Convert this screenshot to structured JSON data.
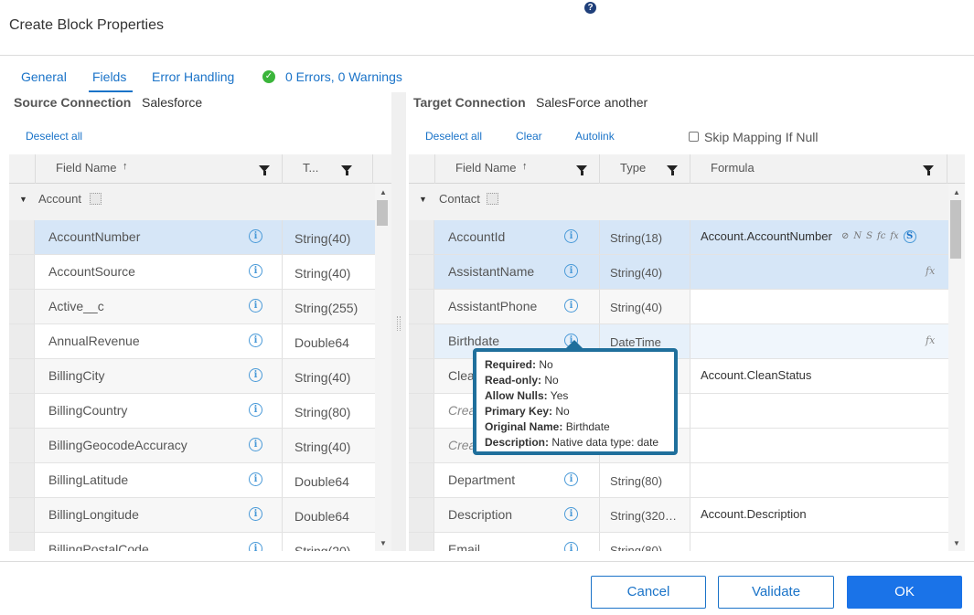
{
  "dialog": {
    "title": "Create Block Properties",
    "help_icon": "?"
  },
  "tabs": [
    "General",
    "Fields",
    "Error Handling"
  ],
  "status": {
    "text": "0 Errors, 0 Warnings",
    "icon": "check-circle-icon",
    "color": "#3bb53b"
  },
  "source": {
    "label": "Source Connection",
    "value": "Salesforce",
    "deselect_all": "Deselect all",
    "columns": {
      "field_name": "Field Name",
      "type": "T..."
    },
    "group": "Account",
    "rows": [
      {
        "name": "AccountNumber",
        "type": "String(40)"
      },
      {
        "name": "AccountSource",
        "type": "String(40)"
      },
      {
        "name": "Active__c",
        "type": "String(255)"
      },
      {
        "name": "AnnualRevenue",
        "type": "Double64"
      },
      {
        "name": "BillingCity",
        "type": "String(40)"
      },
      {
        "name": "BillingCountry",
        "type": "String(80)"
      },
      {
        "name": "BillingGeocodeAccuracy",
        "type": "String(40)"
      },
      {
        "name": "BillingLatitude",
        "type": "Double64"
      },
      {
        "name": "BillingLongitude",
        "type": "Double64"
      },
      {
        "name": "BillingPostalCode",
        "type": "String(20)"
      }
    ]
  },
  "target": {
    "label": "Target Connection",
    "value": "SalesForce another",
    "deselect_all": "Deselect all",
    "clear": "Clear",
    "autolink": "Autolink",
    "skip_null": "Skip Mapping If Null",
    "columns": {
      "field_name": "Field Name",
      "type": "Type",
      "formula": "Formula"
    },
    "group": "Contact",
    "rows": [
      {
        "name": "AccountId",
        "type": "String(18)",
        "formula": "Account.AccountNumber"
      },
      {
        "name": "AssistantName",
        "type": "String(40)",
        "formula": ""
      },
      {
        "name": "AssistantPhone",
        "type": "String(40)",
        "formula": ""
      },
      {
        "name": "Birthdate",
        "type": "DateTime",
        "formula": ""
      },
      {
        "name": "Clea",
        "type": "",
        "formula": "Account.CleanStatus"
      },
      {
        "name": "Crea",
        "type": "",
        "formula": ""
      },
      {
        "name": "Crea",
        "type": "",
        "formula": ""
      },
      {
        "name": "Department",
        "type": "String(80)",
        "formula": ""
      },
      {
        "name": "Description",
        "type": "String(320…",
        "formula": "Account.Description"
      },
      {
        "name": "Email",
        "type": "String(80)",
        "formula": ""
      }
    ],
    "formula_tools": [
      "⊘",
      "N",
      "S",
      "fc",
      "fx",
      "S"
    ]
  },
  "tooltip": [
    {
      "key": "Required:",
      "val": "No"
    },
    {
      "key": "Read-only:",
      "val": "No"
    },
    {
      "key": "Allow Nulls:",
      "val": "Yes"
    },
    {
      "key": "Primary Key:",
      "val": "No"
    },
    {
      "key": "Original Name:",
      "val": "Birthdate"
    },
    {
      "key": "Description:",
      "val": "Native data type: date"
    }
  ],
  "footer": {
    "cancel": "Cancel",
    "validate": "Validate",
    "ok": "OK"
  },
  "colors": {
    "accent": "#1a73c8",
    "primary_button": "#1a73e8",
    "selected_row": "#d6e6f7",
    "tooltip_border": "#1f6f9c"
  }
}
